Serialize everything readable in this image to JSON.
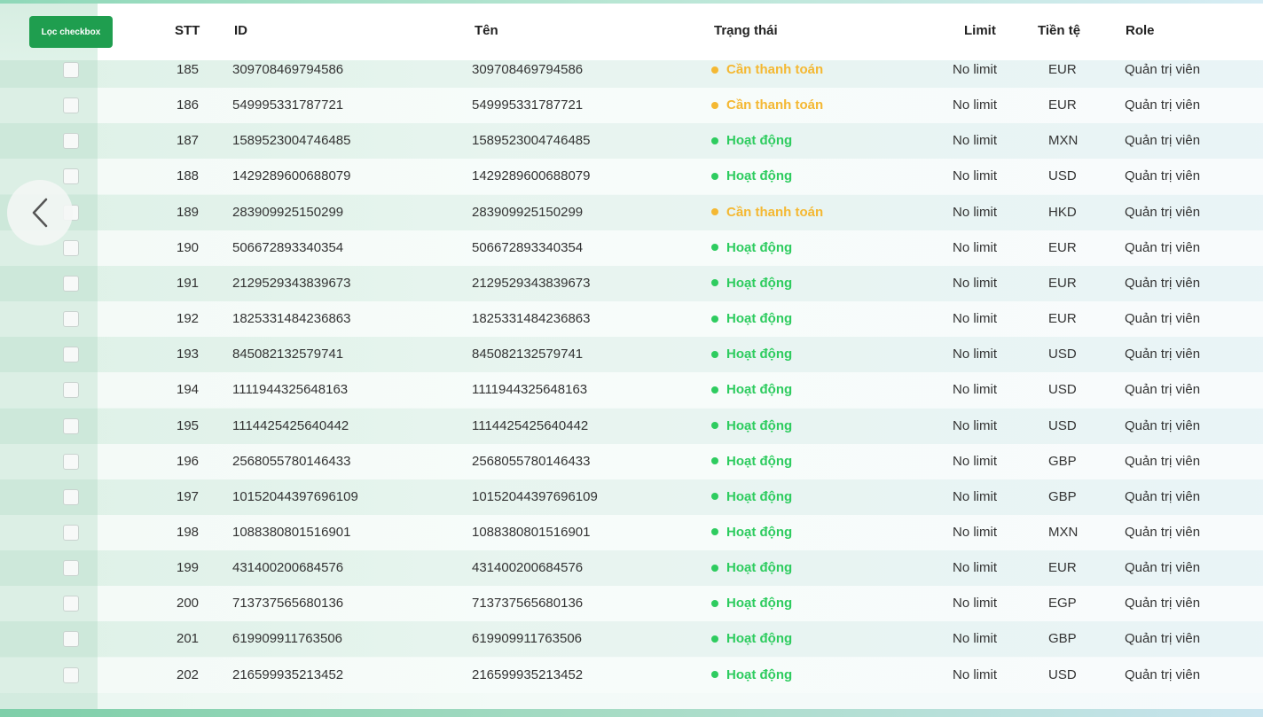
{
  "toolbar": {
    "filter_label": "Lọc checkbox"
  },
  "table": {
    "headers": {
      "stt": "STT",
      "id": "ID",
      "name": "Tên",
      "status": "Trạng thái",
      "limit": "Limit",
      "currency": "Tiền tệ",
      "role": "Role"
    },
    "rows": [
      {
        "stt": "185",
        "id": "309708469794586",
        "name": "309708469794586",
        "status": "Cần thanh toán",
        "status_type": "pay",
        "limit": "No limit",
        "currency": "EUR",
        "role": "Quản trị viên"
      },
      {
        "stt": "186",
        "id": "549995331787721",
        "name": "549995331787721",
        "status": "Cần thanh toán",
        "status_type": "pay",
        "limit": "No limit",
        "currency": "EUR",
        "role": "Quản trị viên"
      },
      {
        "stt": "187",
        "id": "1589523004746485",
        "name": "1589523004746485",
        "status": "Hoạt động",
        "status_type": "active",
        "limit": "No limit",
        "currency": "MXN",
        "role": "Quản trị viên"
      },
      {
        "stt": "188",
        "id": "1429289600688079",
        "name": "1429289600688079",
        "status": "Hoạt động",
        "status_type": "active",
        "limit": "No limit",
        "currency": "USD",
        "role": "Quản trị viên"
      },
      {
        "stt": "189",
        "id": "283909925150299",
        "name": "283909925150299",
        "status": "Cần thanh toán",
        "status_type": "pay",
        "limit": "No limit",
        "currency": "HKD",
        "role": "Quản trị viên"
      },
      {
        "stt": "190",
        "id": "506672893340354",
        "name": "506672893340354",
        "status": "Hoạt động",
        "status_type": "active",
        "limit": "No limit",
        "currency": "EUR",
        "role": "Quản trị viên"
      },
      {
        "stt": "191",
        "id": "2129529343839673",
        "name": "2129529343839673",
        "status": "Hoạt động",
        "status_type": "active",
        "limit": "No limit",
        "currency": "EUR",
        "role": "Quản trị viên"
      },
      {
        "stt": "192",
        "id": "1825331484236863",
        "name": "1825331484236863",
        "status": "Hoạt động",
        "status_type": "active",
        "limit": "No limit",
        "currency": "EUR",
        "role": "Quản trị viên"
      },
      {
        "stt": "193",
        "id": "845082132579741",
        "name": "845082132579741",
        "status": "Hoạt động",
        "status_type": "active",
        "limit": "No limit",
        "currency": "USD",
        "role": "Quản trị viên"
      },
      {
        "stt": "194",
        "id": "1111944325648163",
        "name": "1111944325648163",
        "status": "Hoạt động",
        "status_type": "active",
        "limit": "No limit",
        "currency": "USD",
        "role": "Quản trị viên"
      },
      {
        "stt": "195",
        "id": "1114425425640442",
        "name": "1114425425640442",
        "status": "Hoạt động",
        "status_type": "active",
        "limit": "No limit",
        "currency": "USD",
        "role": "Quản trị viên"
      },
      {
        "stt": "196",
        "id": "2568055780146433",
        "name": "2568055780146433",
        "status": "Hoạt động",
        "status_type": "active",
        "limit": "No limit",
        "currency": "GBP",
        "role": "Quản trị viên"
      },
      {
        "stt": "197",
        "id": "10152044397696109",
        "name": "10152044397696109",
        "status": "Hoạt động",
        "status_type": "active",
        "limit": "No limit",
        "currency": "GBP",
        "role": "Quản trị viên"
      },
      {
        "stt": "198",
        "id": "1088380801516901",
        "name": "1088380801516901",
        "status": "Hoạt động",
        "status_type": "active",
        "limit": "No limit",
        "currency": "MXN",
        "role": "Quản trị viên"
      },
      {
        "stt": "199",
        "id": "431400200684576",
        "name": "431400200684576",
        "status": "Hoạt động",
        "status_type": "active",
        "limit": "No limit",
        "currency": "EUR",
        "role": "Quản trị viên"
      },
      {
        "stt": "200",
        "id": "713737565680136",
        "name": "713737565680136",
        "status": "Hoạt động",
        "status_type": "active",
        "limit": "No limit",
        "currency": "EGP",
        "role": "Quản trị viên"
      },
      {
        "stt": "201",
        "id": "619909911763506",
        "name": "619909911763506",
        "status": "Hoạt động",
        "status_type": "active",
        "limit": "No limit",
        "currency": "GBP",
        "role": "Quản trị viên"
      },
      {
        "stt": "202",
        "id": "216599935213452",
        "name": "216599935213452",
        "status": "Hoạt động",
        "status_type": "active",
        "limit": "No limit",
        "currency": "USD",
        "role": "Quản trị viên"
      }
    ]
  },
  "nav": {
    "back_icon": "chevron-left-icon"
  },
  "colors": {
    "primary_button": "#1f9e4f",
    "status_active": "#2ecc5f",
    "status_pay": "#f4b833"
  }
}
